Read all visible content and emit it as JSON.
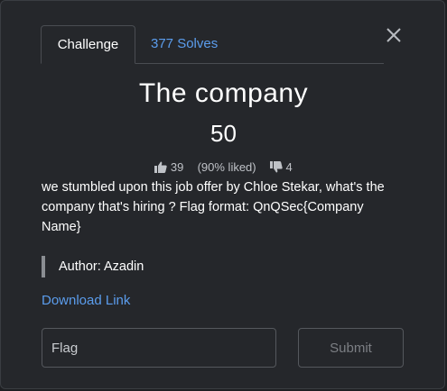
{
  "tabs": {
    "challenge_label": "Challenge",
    "solves_label": "377 Solves"
  },
  "challenge": {
    "title": "The company",
    "points": "50",
    "likes": "39",
    "liked_percent": "(90% liked)",
    "dislikes": "4",
    "description": "we stumbled upon this job offer by Chloe Stekar, what's the company that's hiring ? Flag format: QnQSec{Company Name}",
    "author": "Author: Azadin",
    "download_label": "Download Link"
  },
  "form": {
    "flag_placeholder": "Flag",
    "submit_label": "Submit"
  },
  "colors": {
    "background": "#25272b",
    "link": "#5b9ded",
    "text": "#ffffff"
  },
  "icons": {
    "close": "close-icon",
    "like": "thumbs-up-icon",
    "dislike": "thumbs-down-icon"
  }
}
